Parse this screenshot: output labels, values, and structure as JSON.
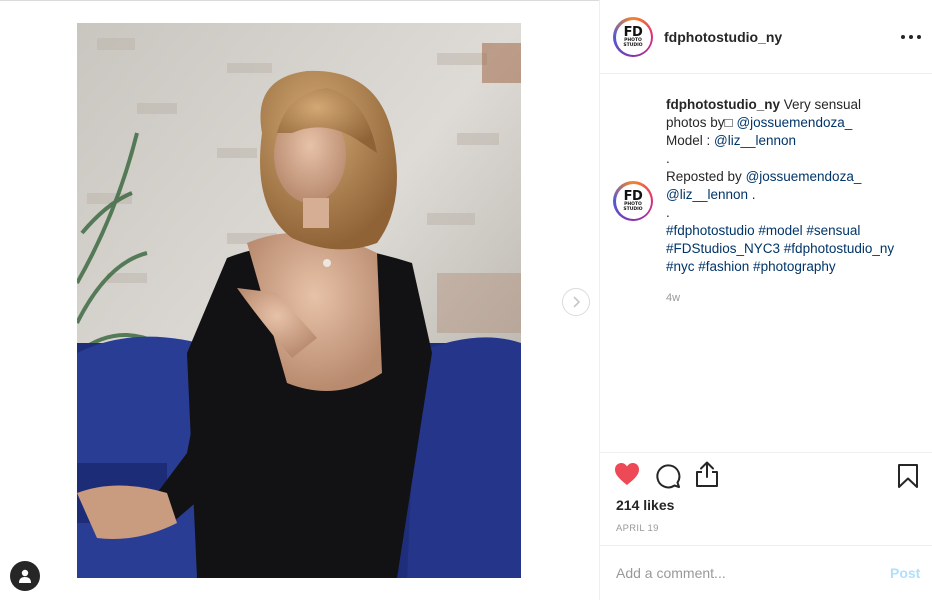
{
  "post": {
    "username": "fdphotostudio_ny",
    "avatar": {
      "text": "FD",
      "subtext": "PHOTO STUDIO"
    },
    "caption": {
      "username": "fdphotostudio_ny",
      "line1_text": " Very sensual",
      "line2_text": "photos by□ ",
      "photographer": "@jossuemendoza_",
      "line3_text": "Model : ",
      "model": "@liz__lennon",
      "dot1": ".",
      "reposted_by_text": "Reposted by ",
      "reposted_by": "@jossuemendoza_",
      "model2": "@liz__lennon",
      "line6_suffix": " .",
      "dot2": ".",
      "hashtag_line1": "#fdphotostudio #model #sensual",
      "hashtag_line2": "#FDStudios_NYC3 #fdphotostudio_ny",
      "hashtag_line3": "#nyc #fashion #photography"
    },
    "time_ago": "4w",
    "likes": "214 likes",
    "date": "APRIL 19"
  },
  "comment_box": {
    "placeholder": "Add a comment...",
    "post_label": "Post"
  },
  "icons": {
    "more": "more-options-icon",
    "heart": "heart-icon",
    "comment": "comment-icon",
    "share": "share-icon",
    "bookmark": "bookmark-icon",
    "next": "chevron-right-icon",
    "profile": "user-icon"
  },
  "colors": {
    "heart": "#ed4956",
    "link": "#003569",
    "post_button": "#b2dffc"
  }
}
